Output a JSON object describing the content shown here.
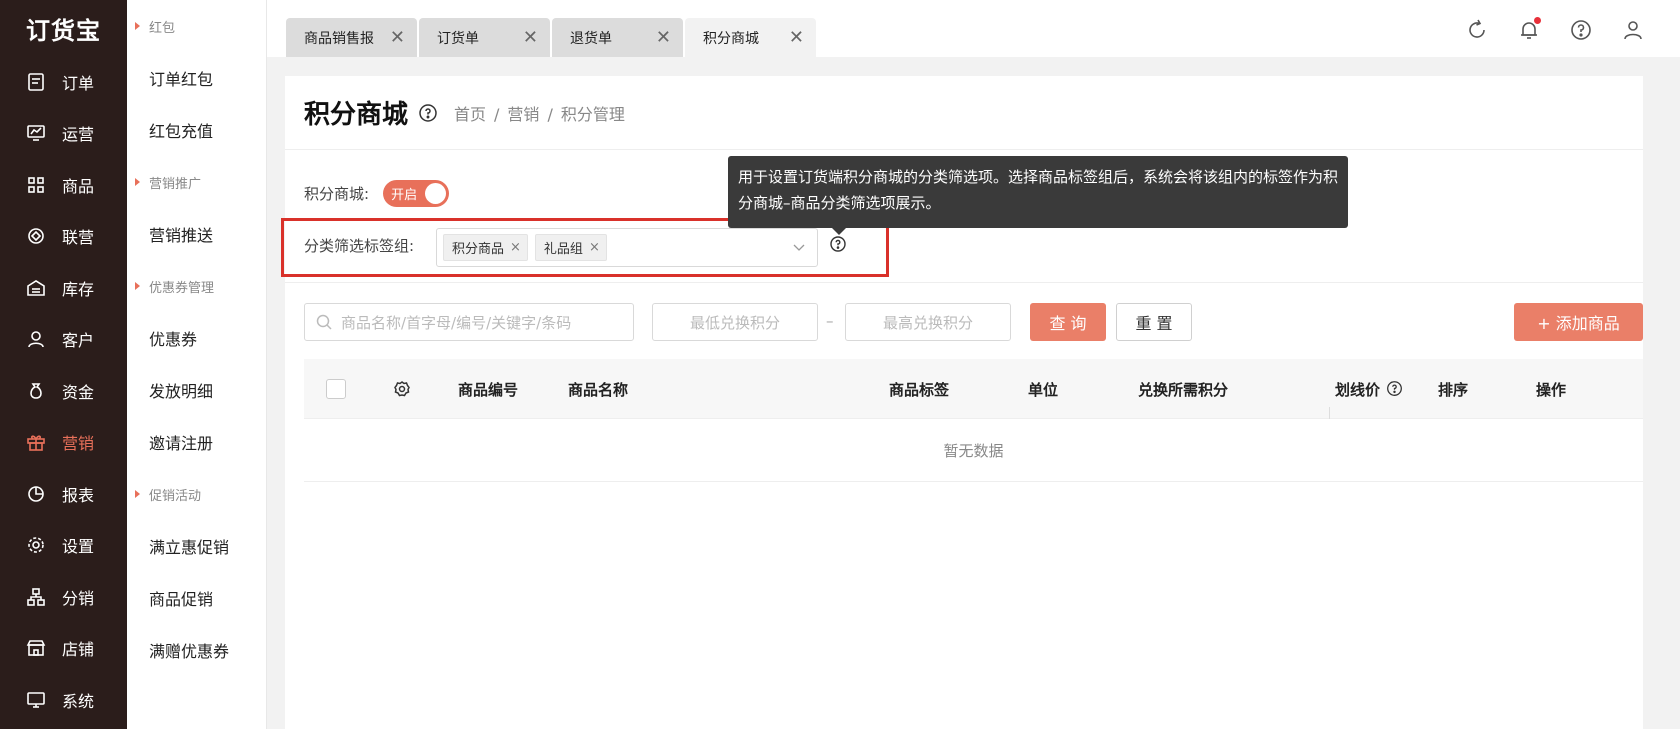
{
  "nav": {
    "logo": "订货宝",
    "items": [
      {
        "label": "订单",
        "icon": "order-icon"
      },
      {
        "label": "运营",
        "icon": "operation-icon"
      },
      {
        "label": "商品",
        "icon": "product-icon"
      },
      {
        "label": "联营",
        "icon": "joint-icon"
      },
      {
        "label": "库存",
        "icon": "inventory-icon"
      },
      {
        "label": "客户",
        "icon": "customer-icon"
      },
      {
        "label": "资金",
        "icon": "money-icon"
      },
      {
        "label": "营销",
        "icon": "gift-icon",
        "active": true
      },
      {
        "label": "报表",
        "icon": "chart-icon"
      },
      {
        "label": "设置",
        "icon": "settings-icon"
      },
      {
        "label": "分销",
        "icon": "distribution-icon"
      },
      {
        "label": "店铺",
        "icon": "store-icon"
      },
      {
        "label": "系统",
        "icon": "system-icon"
      }
    ]
  },
  "submenu": {
    "group1": "红包",
    "g1_items": [
      "订单红包",
      "红包充值"
    ],
    "group2": "营销推广",
    "g2_items": [
      "营销推送"
    ],
    "group3": "优惠券管理",
    "g3_items": [
      "优惠券",
      "发放明细",
      "邀请注册"
    ],
    "group4": "促销活动",
    "g4_items": [
      "满立惠促销",
      "商品促销",
      "满赠优惠券"
    ]
  },
  "tabs": [
    {
      "label": "商品销售报",
      "close": "✕"
    },
    {
      "label": "订货单",
      "close": "✕"
    },
    {
      "label": "退货单",
      "close": "✕"
    },
    {
      "label": "积分商城",
      "close": "✕",
      "active": true
    }
  ],
  "header": {
    "title": "积分商城",
    "breadcrumb": [
      "首页",
      "营销",
      "积分管理"
    ],
    "sep": "/"
  },
  "form": {
    "switch_label": "积分商城:",
    "switch_text": "开启",
    "filter_label": "分类筛选标签组:",
    "chips": [
      "积分商品",
      "礼品组"
    ],
    "chip_close": "×",
    "tooltip": "用于设置订货端积分商城的分类筛选项。选择商品标签组后，系统会将该组内的标签作为积分商城–商品分类筛选项展示。"
  },
  "toolbar": {
    "search_placeholder": "商品名称/首字母/编号/关键字/条码",
    "min_points": "最低兑换积分",
    "dash": "–",
    "max_points": "最高兑换积分",
    "query": "查 询",
    "reset": "重 置",
    "add": "+ 添加商品"
  },
  "table": {
    "columns": [
      "商品编号",
      "商品名称",
      "商品标签",
      "单位",
      "兑换所需积分",
      "划线价",
      "排序",
      "操作"
    ],
    "empty": "暂无数据"
  },
  "colors": {
    "accent": "#e8705a",
    "nav_bg": "#2b1d1b",
    "highlight": "#d9312a"
  }
}
